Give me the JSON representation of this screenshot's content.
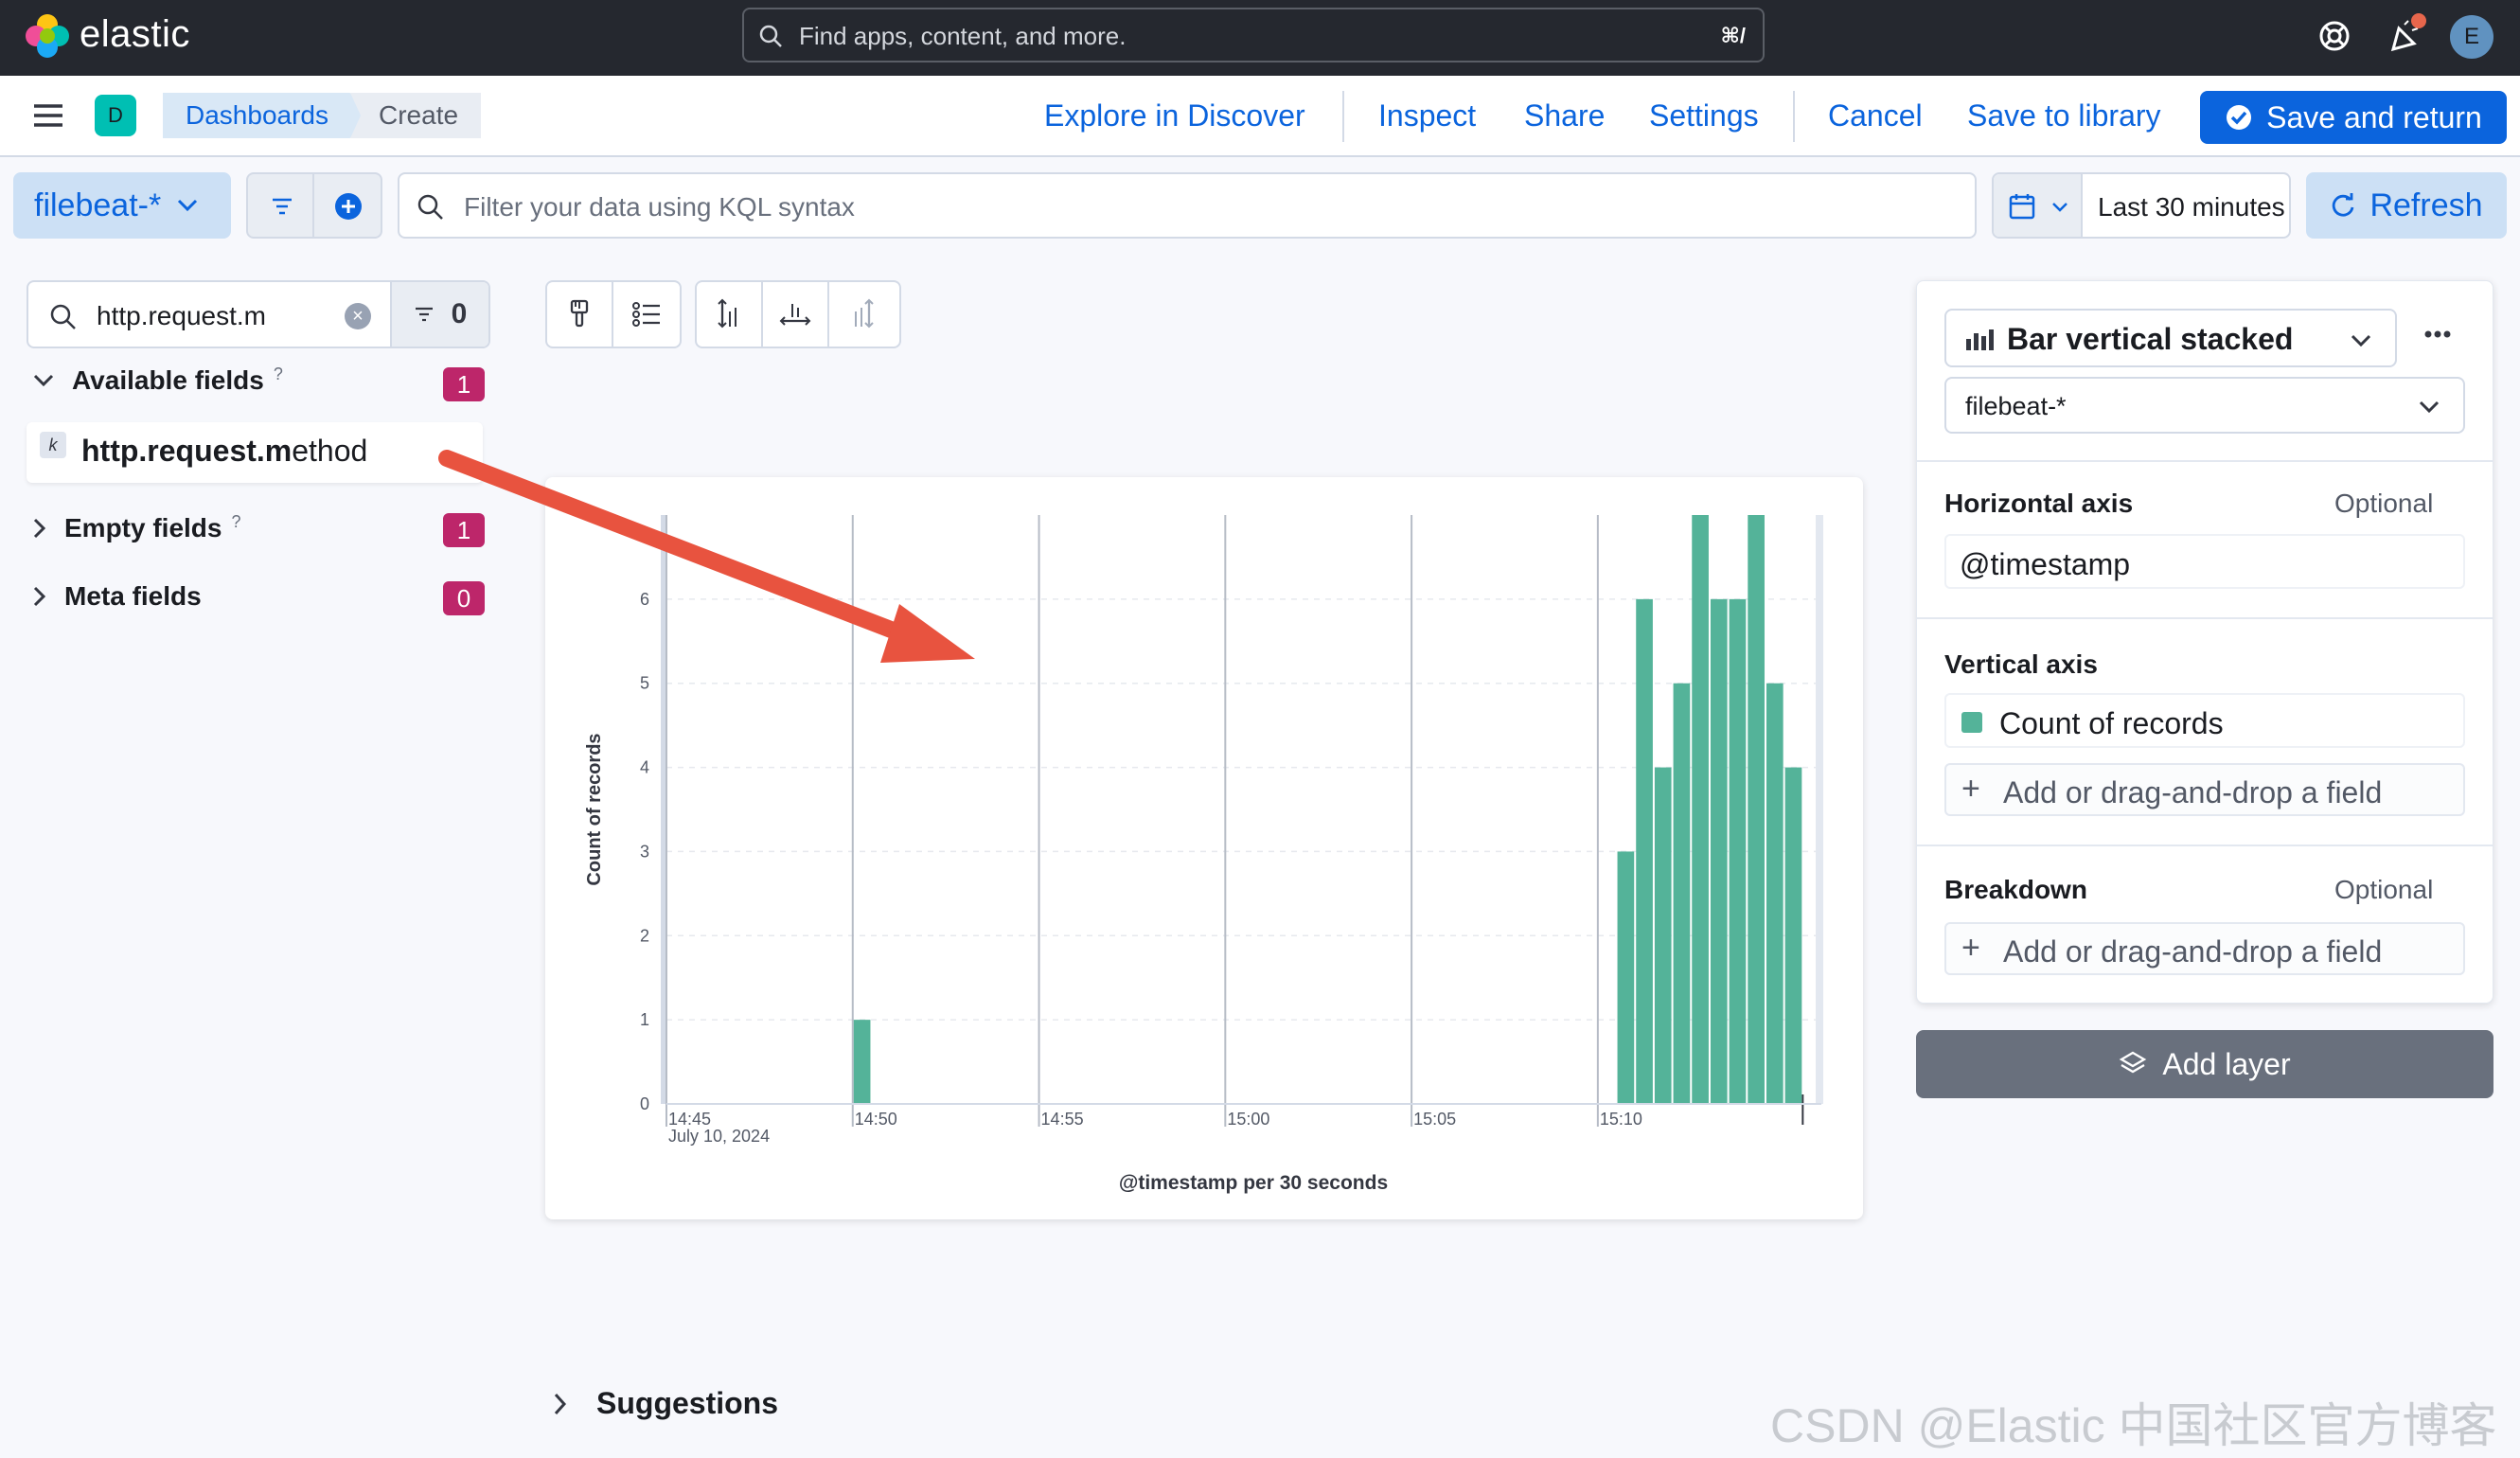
{
  "app": {
    "name": "elastic"
  },
  "header": {
    "search_placeholder": "Find apps, content, and more.",
    "search_shortcut": "⌘/",
    "avatar_initial": "E"
  },
  "breadcrumbs": {
    "space_badge": "D",
    "items": [
      "Dashboards",
      "Create"
    ]
  },
  "actions": {
    "explore": "Explore in Discover",
    "inspect": "Inspect",
    "share": "Share",
    "settings": "Settings",
    "cancel": "Cancel",
    "save_library": "Save to library",
    "save_return": "Save and return"
  },
  "querybar": {
    "data_view": "filebeat-*",
    "kql_placeholder": "Filter your data using KQL syntax",
    "time_range": "Last 30 minutes",
    "refresh": "Refresh"
  },
  "fields_panel": {
    "search_value": "http.request.m",
    "filter_count": "0",
    "sections": [
      {
        "label": "Available fields",
        "count": "1"
      },
      {
        "label": "Empty fields",
        "count": "1"
      },
      {
        "label": "Meta fields",
        "count": "0"
      }
    ],
    "field_type": "k",
    "field_match": "http.request.m",
    "field_rest": "ethod"
  },
  "chart_data": {
    "type": "bar",
    "subtype": "vertical stacked",
    "ylabel": "Count of records",
    "xlabel": "@timestamp per 30 seconds",
    "ylim": [
      0,
      7
    ],
    "yticks": [
      "0",
      "1",
      "2",
      "3",
      "4",
      "5",
      "6"
    ],
    "xticks": [
      "14:45",
      "14:50",
      "14:55",
      "15:00",
      "15:05",
      "15:10"
    ],
    "x_sublabel": "July 10, 2024",
    "grid": true,
    "bar_color": "#54b399",
    "series": [
      {
        "name": "Count of records",
        "x": [
          "14:50:00",
          "15:10:30",
          "15:11:00",
          "15:11:30",
          "15:12:00",
          "15:12:30",
          "15:13:00",
          "15:13:30",
          "15:14:00",
          "15:14:30",
          "15:15:00"
        ],
        "values": [
          1,
          3,
          6,
          4,
          5,
          7,
          6,
          6,
          7,
          5,
          4
        ]
      }
    ]
  },
  "config": {
    "vis_type": "Bar vertical stacked",
    "data_view": "filebeat-*",
    "horizontal_axis": {
      "title": "Horizontal axis",
      "optional": "Optional",
      "value": "@timestamp"
    },
    "vertical_axis": {
      "title": "Vertical axis",
      "value": "Count of records",
      "color": "#54b399",
      "add": "Add or drag-and-drop a field"
    },
    "breakdown": {
      "title": "Breakdown",
      "optional": "Optional",
      "add": "Add or drag-and-drop a field"
    },
    "add_layer": "Add layer"
  },
  "suggestions": {
    "label": "Suggestions"
  },
  "watermark": "CSDN @Elastic 中国社区官方博客",
  "colors": {
    "accent": "#0b64dd",
    "header_bg": "#25282f",
    "bar": "#54b399",
    "badge": "#bd266a",
    "arrow": "#e8533f"
  }
}
